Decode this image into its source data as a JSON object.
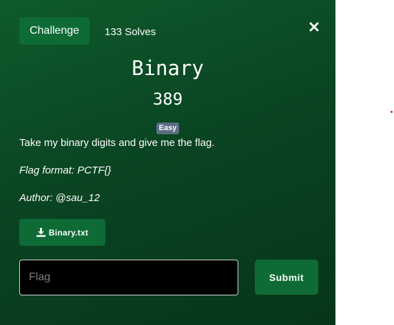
{
  "modal": {
    "tabs": {
      "challenge": "Challenge",
      "solves": "133 Solves"
    },
    "close_icon": "close-icon",
    "title": "Binary",
    "points": "389",
    "difficulty_badge": "Easy",
    "description": "Take my binary digits and give me the flag.",
    "flag_format": "Flag format: PCTF{}",
    "author": "Author: @sau_12",
    "file": {
      "label": "Binary.txt",
      "icon": "download-icon"
    },
    "flag_input": {
      "placeholder": "Flag",
      "value": ""
    },
    "submit_label": "Submit"
  },
  "colors": {
    "modal_bg": "#0a4522",
    "button_bg": "#0e6b36",
    "badge_bg": "#5a6e84",
    "input_bg": "#000000"
  }
}
